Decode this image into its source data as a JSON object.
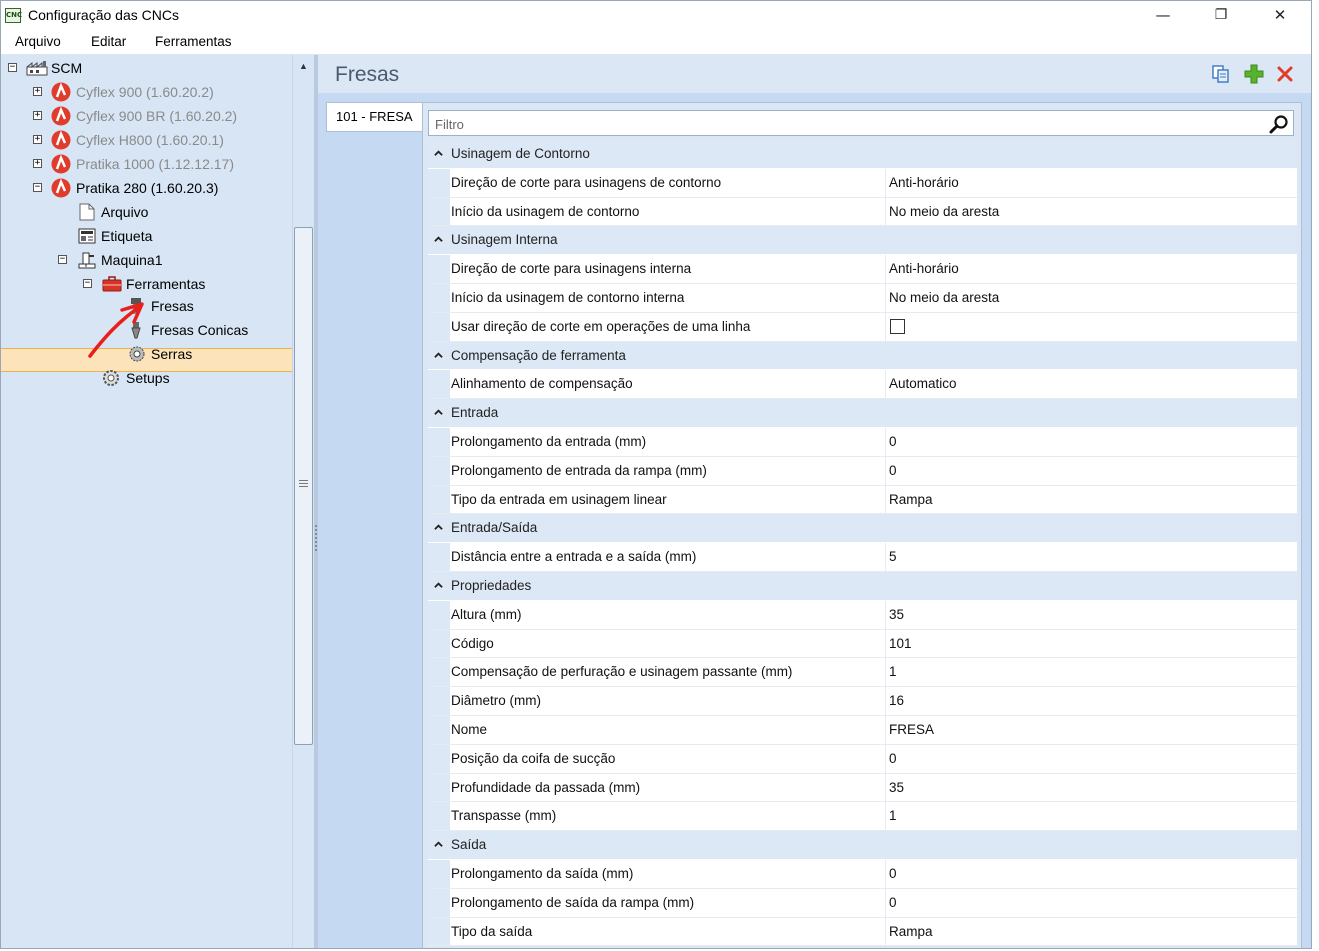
{
  "window": {
    "title": "Configuração das CNCs",
    "app_icon_text": "CNC",
    "minimize": "—",
    "restore": "❐",
    "close": "✕"
  },
  "menu": [
    "Arquivo",
    "Editar",
    "Ferramentas"
  ],
  "tree": {
    "root": "SCM",
    "machines": [
      {
        "label": "Cyflex 900 (1.60.20.2)",
        "expander": "+",
        "active": false
      },
      {
        "label": "Cyflex 900 BR (1.60.20.2)",
        "expander": "+",
        "active": false
      },
      {
        "label": "Cyflex H800 (1.60.20.1)",
        "expander": "+",
        "active": false
      },
      {
        "label": "Pratika 1000 (1.12.12.17)",
        "expander": "+",
        "active": false
      },
      {
        "label": "Pratika 280 (1.60.20.3)",
        "expander": "−",
        "active": true
      }
    ],
    "children": {
      "arquivo": "Arquivo",
      "etiqueta": "Etiqueta",
      "maquina": "Maquina1",
      "ferramentas": "Ferramentas",
      "fresas": "Fresas",
      "fresas_conicas": "Fresas Conicas",
      "serras": "Serras",
      "setups": "Setups"
    },
    "selected": "Fresas"
  },
  "main": {
    "title": "Fresas",
    "tab": "101 - FRESA",
    "filter_placeholder": "Filtro",
    "categories": [
      {
        "label": "Usinagem de Contorno",
        "props": [
          {
            "name": "Direção de corte para usinagens de contorno",
            "value": "Anti-horário"
          },
          {
            "name": "Início da usinagem de contorno",
            "value": "No meio da aresta"
          }
        ]
      },
      {
        "label": "Usinagem Interna",
        "props": [
          {
            "name": "Direção de corte para usinagens interna",
            "value": "Anti-horário"
          },
          {
            "name": "Início da usinagem de contorno interna",
            "value": "No meio da aresta"
          },
          {
            "name": "Usar direção de corte em operações de uma linha",
            "value": "",
            "checkbox": true
          }
        ]
      },
      {
        "label": "Compensação de ferramenta",
        "props": [
          {
            "name": "Alinhamento de compensação",
            "value": "Automatico"
          }
        ]
      },
      {
        "label": "Entrada",
        "props": [
          {
            "name": "Prolongamento da entrada (mm)",
            "value": "0"
          },
          {
            "name": "Prolongamento de entrada da rampa (mm)",
            "value": "0"
          },
          {
            "name": "Tipo da entrada em usinagem linear",
            "value": "Rampa"
          }
        ]
      },
      {
        "label": "Entrada/Saída",
        "props": [
          {
            "name": "Distância entre a entrada e a saída (mm)",
            "value": "5"
          }
        ]
      },
      {
        "label": "Propriedades",
        "props": [
          {
            "name": "Altura (mm)",
            "value": "35"
          },
          {
            "name": "Código",
            "value": "101"
          },
          {
            "name": "Compensação de perfuração e usinagem passante (mm)",
            "value": "1"
          },
          {
            "name": "Diâmetro (mm)",
            "value": "16"
          },
          {
            "name": "Nome",
            "value": "FRESA"
          },
          {
            "name": "Posição da coifa de sucção",
            "value": "0"
          },
          {
            "name": "Profundidade da passada (mm)",
            "value": "35"
          },
          {
            "name": "Transpasse (mm)",
            "value": "1"
          }
        ]
      },
      {
        "label": "Saída",
        "props": [
          {
            "name": "Prolongamento da saída (mm)",
            "value": "0"
          },
          {
            "name": "Prolongamento de saída da rampa (mm)",
            "value": "0"
          },
          {
            "name": "Tipo da saída",
            "value": "Rampa"
          }
        ]
      }
    ]
  },
  "colors": {
    "accent_red": "#e03c2c",
    "selection": "#fde3ba",
    "panel_bg": "#d8e5f4",
    "grid_category": "#dde8f6"
  }
}
